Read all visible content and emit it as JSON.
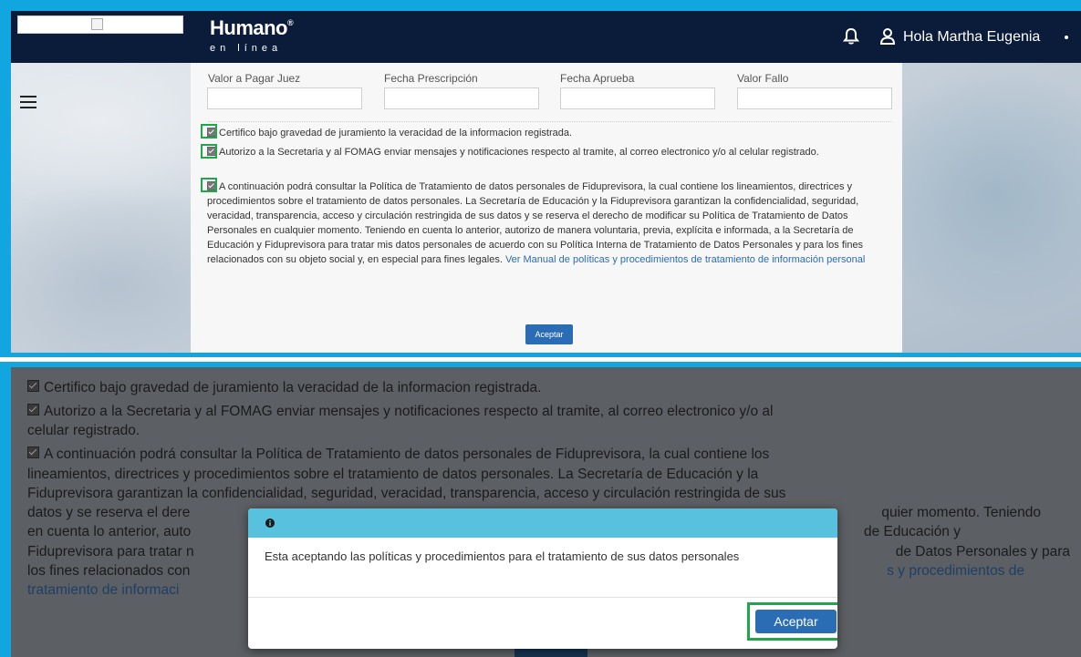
{
  "header": {
    "brand_name": "Humano",
    "brand_reg": "®",
    "brand_sub": "en línea",
    "greeting": "Hola Martha Eugenia"
  },
  "form": {
    "fields": [
      {
        "label": "Valor a Pagar Juez",
        "value": ""
      },
      {
        "label": "Fecha Prescripción",
        "value": ""
      },
      {
        "label": "Fecha Aprueba",
        "value": ""
      },
      {
        "label": "Valor Fallo",
        "value": ""
      }
    ],
    "checks": [
      {
        "checked": true,
        "text": "Certifico bajo gravedad de juramiento la veracidad de la informacion registrada."
      },
      {
        "checked": true,
        "text": "Autorizo a la Secretaria y al FOMAG enviar mensajes y notificaciones respecto al tramite, al correo electronico y/o al celular registrado."
      },
      {
        "checked": true,
        "text": "A continuación podrá consultar la Política de Tratamiento de datos personales de Fiduprevisora, la cual contiene los lineamientos, directrices y procedimientos sobre el tratamiento de datos personales. La Secretaría de Educación y la Fiduprevisora garantizan la confidencialidad, seguridad, veracidad, transparencia, acceso y circulación restringida de sus datos y se reserva el derecho de modificar su Política de Tratamiento de Datos Personales en cualquier momento. Teniendo en cuenta lo anterior, autorizo de manera voluntaria, previa, explícita e informada, a la Secretaría de Educación y Fiduprevisora para tratar mis datos personales de acuerdo con su Política Interna de Tratamiento de Datos Personales y para los fines relacionados con su objeto social y, en especial para fines legales.",
        "link": "Ver Manual de políticas y procedimientos de tratamiento de información personal"
      }
    ],
    "accept_label": "Aceptar"
  },
  "zoom": {
    "lines": [
      {
        "parts": [
          "Certifico bajo gravedad de juramiento la veracidad de la informacion registrada."
        ]
      },
      {
        "parts": [
          "Autorizo a la Secretaria y al FOMAG enviar mensajes y notificaciones respecto al tramite, al correo electronico y/o al"
        ]
      },
      {
        "parts": [
          "celular registrado."
        ]
      },
      {
        "parts": [
          "A continuación podrá consultar la Política de Tratamiento de datos personales de Fiduprevisora, la cual contiene los"
        ]
      },
      {
        "parts": [
          "lineamientos, directrices y procedimientos sobre el tratamiento de datos personales. La Secretaría de Educación y la"
        ]
      },
      {
        "parts": [
          "Fiduprevisora garantizan la confidencialidad, seguridad, veracidad, transparencia, acceso y circulación restringida de sus"
        ]
      },
      {
        "parts": [
          "datos y se reserva el dere",
          "quier momento. Teniendo"
        ]
      },
      {
        "parts": [
          "en cuenta lo anterior, auto",
          "de Educación y"
        ]
      },
      {
        "parts": [
          "Fiduprevisora para tratar n",
          "de Datos Personales y para"
        ]
      },
      {
        "parts": [
          "los fines relacionados con",
          "s y procedimientos de"
        ]
      },
      {
        "parts": [
          "tratamiento de informaci"
        ]
      }
    ]
  },
  "modal": {
    "message": "Esta aceptando las políticas y procedimientos para el tratamiento de sus datos personales",
    "accept_label": "Aceptar"
  },
  "icons": {
    "bell": "bell-icon",
    "user": "user-icon",
    "menu": "hamburger-icon",
    "info": "info-icon"
  },
  "colors": {
    "frame": "#11a6e0",
    "navbar": "#0b1c3a",
    "primary": "#2a6db5",
    "modal_header": "#58c1dd",
    "highlight": "#1fa74a"
  }
}
